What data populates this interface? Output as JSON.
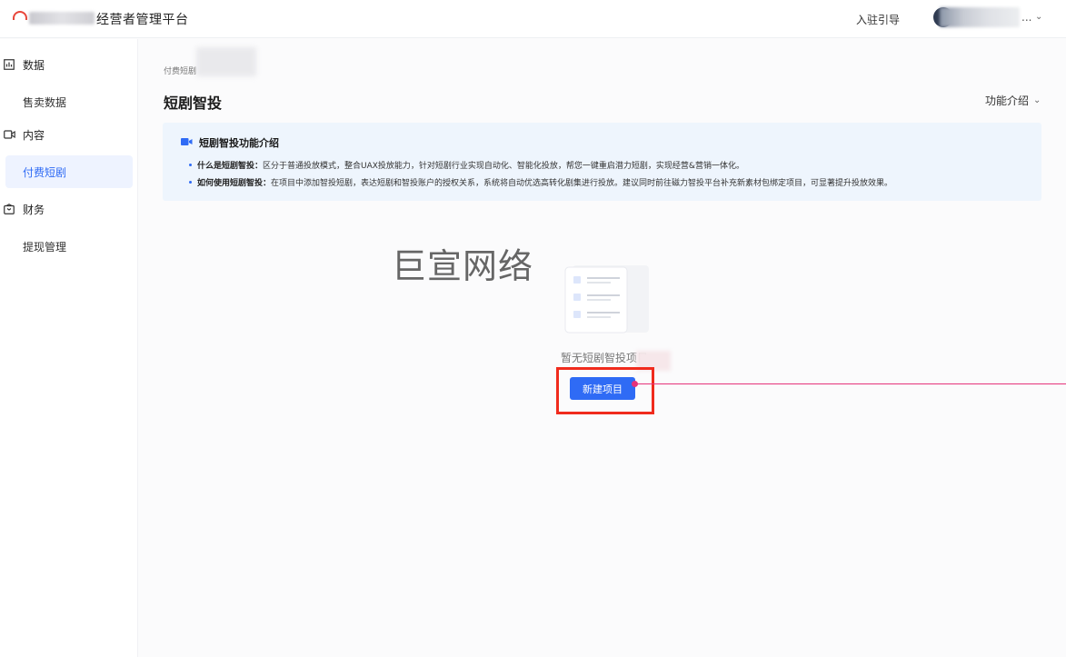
{
  "header": {
    "brand_title": "经营者管理平台",
    "join_guide": "入驻引导",
    "user_ellipsis": "...",
    "brand_color": "#e8463a"
  },
  "sidebar": {
    "groups": [
      {
        "label": "数据",
        "icon": "bar-chart-icon",
        "items": [
          {
            "label": "售卖数据",
            "active": false
          }
        ]
      },
      {
        "label": "内容",
        "icon": "video-camera-icon",
        "items": [
          {
            "label": "付费短剧",
            "active": true
          }
        ]
      },
      {
        "label": "财务",
        "icon": "wallet-icon",
        "items": [
          {
            "label": "提现管理",
            "active": false
          }
        ]
      }
    ]
  },
  "main": {
    "breadcrumb": "付费短剧",
    "page_title": "短剧智投",
    "func_intro": "功能介绍",
    "notice": {
      "title": "短剧智投功能介绍",
      "lines": [
        {
          "key": "什么是短剧智投：",
          "text": "区分于普通投放模式，整合UAX投放能力，针对短剧行业实现自动化、智能化投放，帮您一键重启潜力短剧，实现经营&营销一体化。"
        },
        {
          "key": "如何使用短剧智投：",
          "text": "在项目中添加智投短剧，表达短剧和智投账户的授权关系，系统将自动优选高转化剧集进行投放。建议同时前往磁力智投平台补充新素材包绑定项目，可显著提升投放效果。"
        }
      ]
    },
    "watermark": "巨宣网络",
    "empty_text": "暂无短剧智投项目",
    "new_button": "新建项目"
  },
  "colors": {
    "accent": "#2f6bf5",
    "highlight": "#f02b1d",
    "annotation": "#e5337b",
    "notice_bg": "#eef5fd"
  }
}
